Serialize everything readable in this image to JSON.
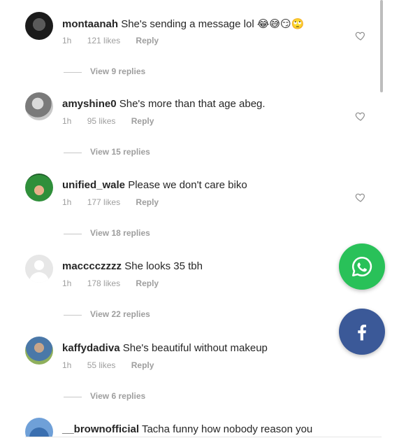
{
  "comments": [
    {
      "username": "montaanah",
      "text": "She's sending a message lol 😂😅😏🙄",
      "time": "1h",
      "likes": "121 likes",
      "reply": "Reply",
      "view_replies": "View 9 replies"
    },
    {
      "username": "amyshine0",
      "text": "She's more than that age abeg.",
      "time": "1h",
      "likes": "95 likes",
      "reply": "Reply",
      "view_replies": "View 15 replies"
    },
    {
      "username": "unified_wale",
      "text": "Please we don't care biko",
      "time": "1h",
      "likes": "177 likes",
      "reply": "Reply",
      "view_replies": "View 18 replies"
    },
    {
      "username": "macccczzzz",
      "text": "She looks 35 tbh",
      "time": "1h",
      "likes": "178 likes",
      "reply": "Reply",
      "view_replies": "View 22 replies"
    },
    {
      "username": "kaffydadiva",
      "text": "She's beautiful without makeup",
      "time": "1h",
      "likes": "55 likes",
      "reply": "Reply",
      "view_replies": "View 6 replies"
    },
    {
      "username": "__brownofficial",
      "text": "Tacha funny how nobody reason you"
    }
  ],
  "share_buttons": {
    "whatsapp_icon": "whatsapp-icon",
    "facebook_icon": "facebook-icon",
    "whatsapp_color": "#29c159",
    "facebook_color": "#3b5998"
  },
  "icons": {
    "like": "heart-icon"
  }
}
